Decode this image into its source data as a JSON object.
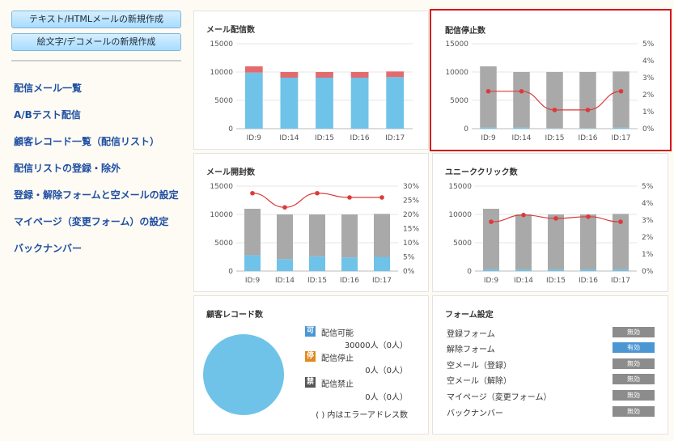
{
  "sidebar": {
    "buttons": [
      "テキスト/HTMLメールの新規作成",
      "絵文字/デコメールの新規作成"
    ],
    "links": [
      "配信メール一覧",
      "A/Bテスト配信",
      "顧客レコード一覧（配信リスト）",
      "配信リストの登録・除外",
      "登録・解除フォームと空メールの設定",
      "マイページ（変更フォーム）の設定",
      "バックナンバー"
    ]
  },
  "colors": {
    "blue": "#6fc3e8",
    "red": "#e36b6e",
    "gray": "#a9a9a9",
    "line": "#dc3a3a",
    "highlight": "#d8141b"
  },
  "charts": {
    "mail": {
      "title": "メール配信数"
    },
    "stop": {
      "title": "配信停止数"
    },
    "open": {
      "title": "メール開封数"
    },
    "click": {
      "title": "ユニーククリック数"
    }
  },
  "chart_data": [
    {
      "id": "mail",
      "type": "bar",
      "title": "メール配信数",
      "categories": [
        "ID:9",
        "ID:14",
        "ID:15",
        "ID:16",
        "ID:17"
      ],
      "series": [
        {
          "values": [
            9900,
            9000,
            9000,
            9000,
            9100
          ],
          "color": "#6fc3e8"
        },
        {
          "values": [
            1100,
            1000,
            1000,
            1000,
            1000
          ],
          "color": "#e36b6e"
        }
      ],
      "ylim": [
        0,
        15000
      ],
      "yticks": [
        "0",
        "5000",
        "10000",
        "15000"
      ]
    },
    {
      "id": "stop",
      "type": "bar",
      "title": "配信停止数",
      "categories": [
        "ID:9",
        "ID:14",
        "ID:15",
        "ID:16",
        "ID:17"
      ],
      "series": [
        {
          "values": [
            200,
            200,
            100,
            100,
            200
          ],
          "color": "#6fc3e8"
        },
        {
          "values": [
            10800,
            9800,
            9900,
            9900,
            9900
          ],
          "color": "#a9a9a9"
        }
      ],
      "line": {
        "values": [
          2.2,
          2.2,
          1.1,
          1.1,
          2.2
        ],
        "color": "#dc3a3a"
      },
      "ylim": [
        0,
        15000
      ],
      "yticks": [
        "0",
        "5000",
        "10000",
        "15000"
      ],
      "y2lim": [
        0,
        5
      ],
      "y2ticks": [
        "0%",
        "1%",
        "2%",
        "3%",
        "4%",
        "5%"
      ]
    },
    {
      "id": "open",
      "type": "bar",
      "title": "メール開封数",
      "categories": [
        "ID:9",
        "ID:14",
        "ID:15",
        "ID:16",
        "ID:17"
      ],
      "series": [
        {
          "values": [
            2800,
            2100,
            2600,
            2400,
            2500
          ],
          "color": "#6fc3e8"
        },
        {
          "values": [
            8200,
            7900,
            7400,
            7600,
            7600
          ],
          "color": "#a9a9a9"
        }
      ],
      "line": {
        "values": [
          27.5,
          22.5,
          27.5,
          26,
          26
        ],
        "color": "#dc3a3a"
      },
      "ylim": [
        0,
        15000
      ],
      "yticks": [
        "0",
        "5000",
        "10000",
        "15000"
      ],
      "y2lim": [
        0,
        30
      ],
      "y2ticks": [
        "0%",
        "5%",
        "10%",
        "15%",
        "20%",
        "25%",
        "30%"
      ]
    },
    {
      "id": "click",
      "type": "bar",
      "title": "ユニーククリック数",
      "categories": [
        "ID:9",
        "ID:14",
        "ID:15",
        "ID:16",
        "ID:17"
      ],
      "series": [
        {
          "values": [
            300,
            300,
            300,
            300,
            300
          ],
          "color": "#6fc3e8"
        },
        {
          "values": [
            10700,
            9700,
            9700,
            9700,
            9800
          ],
          "color": "#a9a9a9"
        }
      ],
      "line": {
        "values": [
          2.9,
          3.3,
          3.1,
          3.2,
          2.9
        ],
        "color": "#dc3a3a"
      },
      "ylim": [
        0,
        15000
      ],
      "yticks": [
        "0",
        "5000",
        "10000",
        "15000"
      ],
      "y2lim": [
        0,
        5
      ],
      "y2ticks": [
        "0%",
        "1%",
        "2%",
        "3%",
        "4%",
        "5%"
      ]
    },
    {
      "id": "customers",
      "type": "pie",
      "title": "顧客レコード数",
      "labels": [
        "配信可能",
        "配信停止",
        "配信禁止"
      ],
      "values": [
        30000,
        0,
        0
      ],
      "color": "#6fc3e8"
    }
  ],
  "customers": {
    "title": "顧客レコード数",
    "legend": [
      {
        "icon": "可",
        "label": "配信可能",
        "value": "30000人（0人）",
        "color": "#4c97d3"
      },
      {
        "icon": "停",
        "label": "配信停止",
        "value": "0人（0人）",
        "color": "#e08a1e"
      },
      {
        "icon": "禁",
        "label": "配信禁止",
        "value": "0人（0人）",
        "color": "#555555"
      }
    ],
    "note": "( ) 内はエラーアドレス数"
  },
  "forms": {
    "title": "フォーム設定",
    "rows": [
      {
        "label": "登録フォーム",
        "status": "無効"
      },
      {
        "label": "解除フォーム",
        "status": "有効"
      },
      {
        "label": "空メール（登録）",
        "status": "無効"
      },
      {
        "label": "空メール（解除）",
        "status": "無効"
      },
      {
        "label": "マイページ（変更フォーム）",
        "status": "無効"
      },
      {
        "label": "バックナンバー",
        "status": "無効"
      }
    ]
  }
}
